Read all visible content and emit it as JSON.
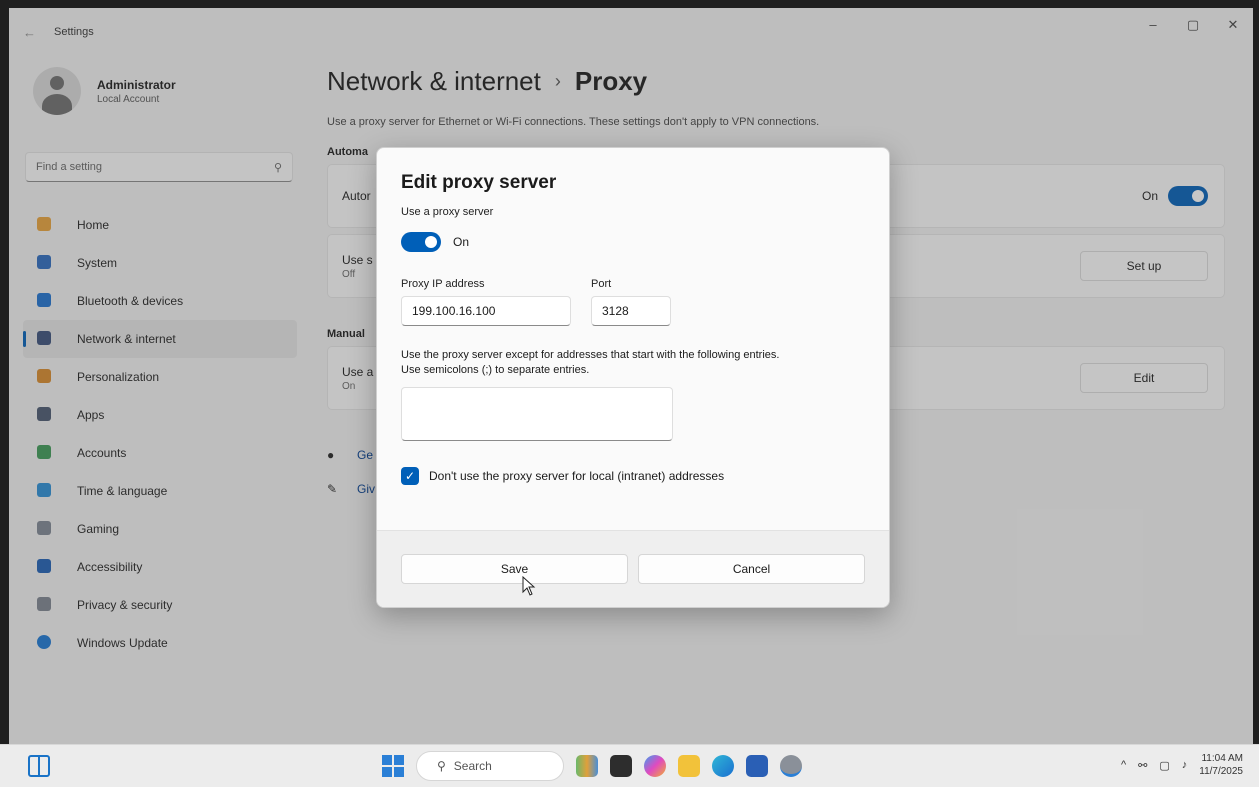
{
  "window": {
    "title": "Settings",
    "controls": [
      "–",
      "▢",
      "✕"
    ]
  },
  "user": {
    "name": "Administrator",
    "account": "Local Account"
  },
  "search": {
    "placeholder": "Find a setting"
  },
  "sidebar": {
    "items": [
      {
        "label": "Home",
        "color": "#e8a23a"
      },
      {
        "label": "System",
        "color": "#2b6bbf"
      },
      {
        "label": "Bluetooth & devices",
        "color": "#1e72d0"
      },
      {
        "label": "Network & internet",
        "color": "#3a4f7a"
      },
      {
        "label": "Personalization",
        "color": "#d98a2a"
      },
      {
        "label": "Apps",
        "color": "#4a5870"
      },
      {
        "label": "Accounts",
        "color": "#3d9a56"
      },
      {
        "label": "Time & language",
        "color": "#2a8fd6"
      },
      {
        "label": "Gaming",
        "color": "#7f8794"
      },
      {
        "label": "Accessibility",
        "color": "#1e5fb5"
      },
      {
        "label": "Privacy & security",
        "color": "#7d8590"
      },
      {
        "label": "Windows Update",
        "color": "#1b78d4"
      }
    ],
    "active_index": 3
  },
  "main": {
    "breadcrumb_parent": "Network & internet",
    "breadcrumb_sep": "›",
    "breadcrumb_current": "Proxy",
    "description": "Use a proxy server for Ethernet or Wi-Fi connections. These settings don't apply to VPN connections.",
    "auto_section": "Automa",
    "auto_card_title": "Autor",
    "auto_card_state": "On",
    "script_card_title": "Use s",
    "script_card_sub": "Off",
    "setup_button": "Set up",
    "manual_section": "Manual",
    "manual_card_title": "Use a",
    "manual_card_sub": "On",
    "edit_button": "Edit",
    "link_help": "Ge",
    "link_feedback": "Giv"
  },
  "dialog": {
    "title": "Edit proxy server",
    "use_proxy_label": "Use a proxy server",
    "toggle_state": "On",
    "ip_label": "Proxy IP address",
    "ip_value": "199.100.16.100",
    "port_label": "Port",
    "port_value": "3128",
    "except_line1": "Use the proxy server except for addresses that start with the following entries.",
    "except_line2": "Use semicolons (;) to separate entries.",
    "except_value": "",
    "local_checkbox_label": "Don't use the proxy server for local (intranet) addresses",
    "local_checked": true,
    "save_label": "Save",
    "cancel_label": "Cancel"
  },
  "taskbar": {
    "search_label": "Search",
    "time": "11:04 AM",
    "date": "11/7/2025",
    "tray_chevron": "^"
  }
}
